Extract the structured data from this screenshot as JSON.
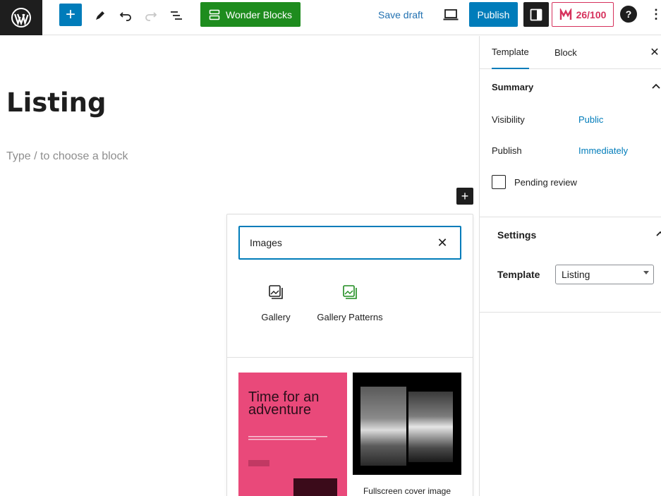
{
  "toolbar": {
    "wonder_blocks_label": "Wonder Blocks",
    "save_draft_label": "Save draft",
    "publish_label": "Publish",
    "seo_score": "26/100",
    "help_label": "?",
    "more_label": "⋮",
    "add_label": "+"
  },
  "editor": {
    "title": "Listing",
    "placeholder": "Type / to choose a block",
    "inline_add_label": "+"
  },
  "inserter": {
    "search_value": "Images",
    "clear_label": "✕",
    "blocks": [
      {
        "label": "Gallery"
      },
      {
        "label": "Gallery Patterns"
      }
    ],
    "patterns": [
      {
        "title": "Time for an adventure"
      },
      {
        "caption": "Fullscreen cover image gallery"
      }
    ]
  },
  "sidebar": {
    "tabs": [
      "Template",
      "Block"
    ],
    "close_label": "✕",
    "summary": {
      "title": "Summary",
      "visibility_label": "Visibility",
      "visibility_value": "Public",
      "publish_label": "Publish",
      "publish_value": "Immediately",
      "pending_label": "Pending review"
    },
    "settings": {
      "title": "Settings",
      "template_label": "Template",
      "template_value": "Listing"
    }
  },
  "colors": {
    "accent": "#007cba",
    "wonder_green": "#1e8c1e",
    "score_red": "#d6315c",
    "pattern_pink": "#e9497a"
  }
}
